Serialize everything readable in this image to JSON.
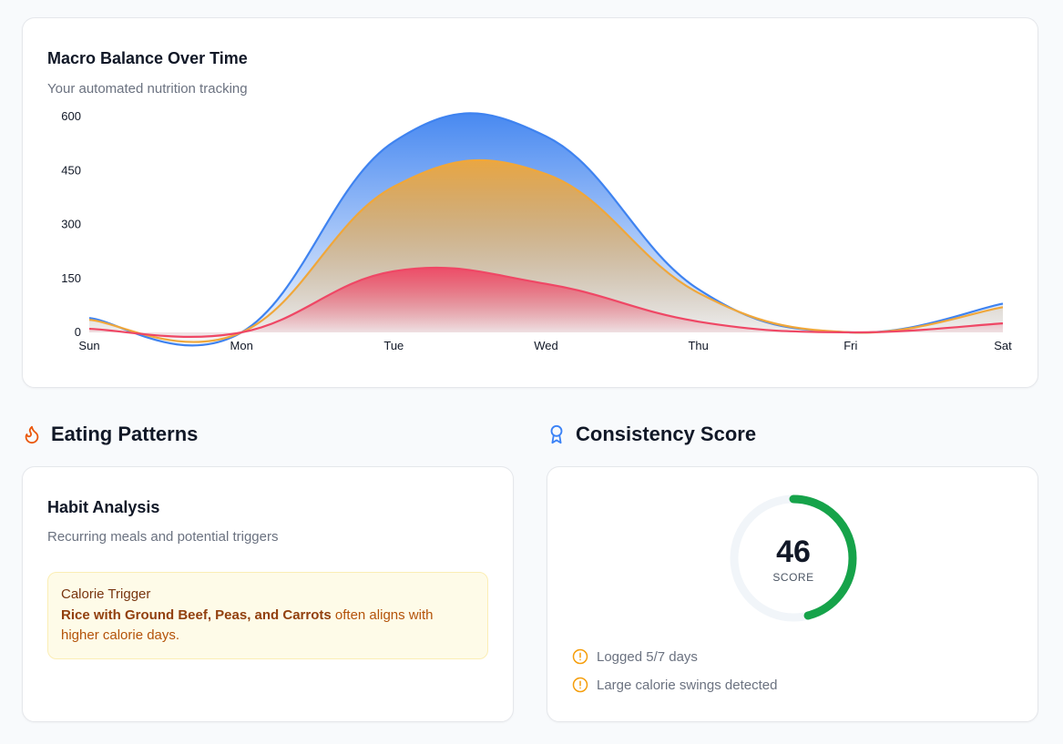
{
  "chart_card": {
    "title": "Macro Balance Over Time",
    "subtitle": "Your automated nutrition tracking"
  },
  "chart_data": {
    "type": "area",
    "categories": [
      "Sun",
      "Mon",
      "Tue",
      "Wed",
      "Thu",
      "Fri",
      "Sat"
    ],
    "ylim": [
      0,
      600
    ],
    "yticks": [
      0,
      150,
      300,
      450,
      600
    ],
    "stacked": true,
    "grid": false,
    "series": [
      {
        "values": [
          10,
          0,
          170,
          135,
          30,
          0,
          25
        ],
        "color": "#ef4765"
      },
      {
        "values": [
          25,
          0,
          235,
          305,
          80,
          0,
          45
        ],
        "color": "#f0a73a"
      },
      {
        "values": [
          5,
          0,
          125,
          105,
          10,
          0,
          10
        ],
        "color": "#3f83f0"
      }
    ]
  },
  "patterns": {
    "heading": "Eating Patterns",
    "icon": "flame-icon",
    "card_title": "Habit Analysis",
    "card_subtitle": "Recurring meals and potential triggers",
    "trigger_title": "Calorie Trigger",
    "trigger_meal": "Rice with Ground Beef, Peas, and Carrots",
    "trigger_text": " often aligns with higher calorie days."
  },
  "consistency": {
    "heading": "Consistency Score",
    "icon": "award-icon",
    "score": "46",
    "score_value": 46,
    "score_max": 100,
    "score_label": "SCORE",
    "ring_color": "#16a34a",
    "notes": [
      "Logged 5/7 days",
      "Large calorie swings detected"
    ]
  }
}
